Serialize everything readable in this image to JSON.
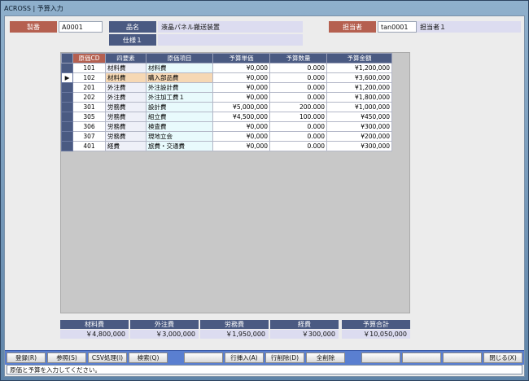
{
  "window": {
    "title": "ACROSS | 予算入力"
  },
  "header": {
    "seiban_label": "製番",
    "seiban_value": "A0001",
    "hinmei_label": "品名",
    "hinmei_value": "液晶パネル搬送装置",
    "shiyo_label": "仕様１",
    "shiyo_value": "",
    "tanto_label": "担当者",
    "tanto_code": "tan0001",
    "tanto_name": "担当者１"
  },
  "grid": {
    "columns": [
      "原価CD",
      "四要素",
      "原価項目",
      "予算単価",
      "予算数量",
      "予算金額"
    ],
    "rows": [
      {
        "cd": "101",
        "youso": "材料費",
        "koumoku": "材料費",
        "tanka": "¥0,000",
        "suryo": "0.000",
        "kingaku": "¥1,200,000"
      },
      {
        "cd": "102",
        "youso": "材料費",
        "koumoku": "購入部品費",
        "tanka": "¥0,000",
        "suryo": "0.000",
        "kingaku": "¥3,600,000"
      },
      {
        "cd": "201",
        "youso": "外注費",
        "koumoku": "外注設計費",
        "tanka": "¥0,000",
        "suryo": "0.000",
        "kingaku": "¥1,200,000"
      },
      {
        "cd": "202",
        "youso": "外注費",
        "koumoku": "外注加工費１",
        "tanka": "¥0,000",
        "suryo": "0.000",
        "kingaku": "¥1,800,000"
      },
      {
        "cd": "301",
        "youso": "労務費",
        "koumoku": "設計費",
        "tanka": "¥5,000,000",
        "suryo": "200.000",
        "kingaku": "¥1,000,000"
      },
      {
        "cd": "305",
        "youso": "労務費",
        "koumoku": "組立費",
        "tanka": "¥4,500,000",
        "suryo": "100.000",
        "kingaku": "¥450,000"
      },
      {
        "cd": "306",
        "youso": "労務費",
        "koumoku": "検査費",
        "tanka": "¥0,000",
        "suryo": "0.000",
        "kingaku": "¥300,000"
      },
      {
        "cd": "307",
        "youso": "労務費",
        "koumoku": "現地立会",
        "tanka": "¥0,000",
        "suryo": "0.000",
        "kingaku": "¥200,000"
      },
      {
        "cd": "401",
        "youso": "経費",
        "koumoku": "旅費・交通費",
        "tanka": "¥0,000",
        "suryo": "0.000",
        "kingaku": "¥300,000"
      }
    ],
    "selected_row_marker": "▶"
  },
  "summary": {
    "zairyo_label": "材料費",
    "zairyo_value": "￥4,800,000",
    "gaichu_label": "外注費",
    "gaichu_value": "￥3,000,000",
    "romu_label": "労務費",
    "romu_value": "￥1,950,000",
    "keihi_label": "経費",
    "keihi_value": "￥300,000",
    "total_label": "予算合計",
    "total_value": "￥10,050,000"
  },
  "buttons": {
    "touroku": "登録(R)",
    "sansho": "参照(S)",
    "csv": "CSV処理(I)",
    "kensaku": "検索(Q)",
    "blank1": "",
    "gyou_sounyu": "行挿入(A)",
    "gyou_sakujo": "行削除(D)",
    "zen_sakujo": "全削除",
    "blank2": "",
    "blank3": "",
    "blank4": "",
    "tojiru": "閉じる(X)"
  },
  "status": {
    "message": "原価と予算を入力してください。"
  }
}
